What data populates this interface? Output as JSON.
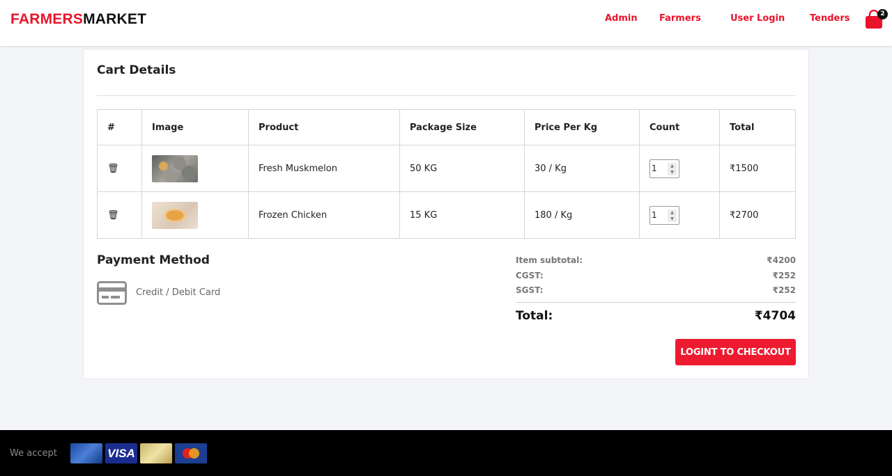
{
  "header": {
    "brand_part1": "FARMERS",
    "brand_part2": "MARKET",
    "nav": [
      "Admin",
      "Farmers",
      "User Login",
      "Tenders"
    ],
    "cart_count": "2",
    "accent_color": "#e9142b"
  },
  "cart": {
    "title": "Cart Details",
    "columns": [
      "#",
      "Image",
      "Product",
      "Package Size",
      "Price Per Kg",
      "Count",
      "Total"
    ],
    "rows": [
      {
        "product": "Fresh Muskmelon",
        "package_size": "50 KG",
        "price_per_kg": "30 / Kg",
        "count": "1",
        "total": "₹1500",
        "delete_icon": "trash-icon",
        "image": "muskmelon-image"
      },
      {
        "product": "Frozen Chicken",
        "package_size": "15 KG",
        "price_per_kg": "180 / Kg",
        "count": "1",
        "total": "₹2700",
        "delete_icon": "trash-icon",
        "image": "chicken-image"
      }
    ]
  },
  "payment": {
    "title": "Payment Method",
    "method_label": "Credit / Debit Card",
    "icon": "credit-card-icon"
  },
  "summary": {
    "subtotal_label": "Item subtotal:",
    "subtotal_value": "₹4200",
    "cgst_label": "CGST:",
    "cgst_value": "₹252",
    "sgst_label": "SGST:",
    "sgst_value": "₹252",
    "total_label": "Total:",
    "total_value": "₹4704"
  },
  "checkout_label": "LOGINT TO CHECKOUT",
  "footer": {
    "accept_label": "We accept",
    "cards": [
      "debit-card",
      "VISA",
      "gold-card",
      "mastercard"
    ]
  }
}
